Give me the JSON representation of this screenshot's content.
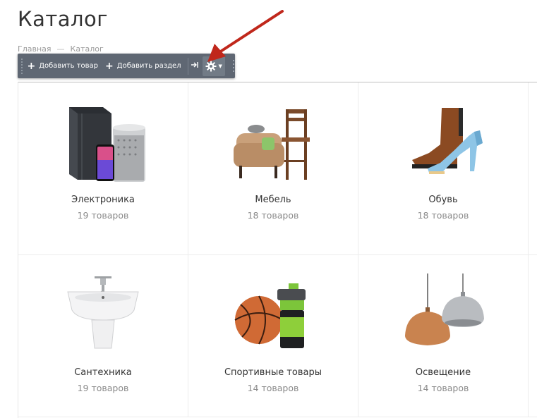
{
  "page": {
    "title": "Каталог",
    "breadcrumb": {
      "home": "Главная",
      "separator": "—",
      "current": "Каталог"
    }
  },
  "toolbar": {
    "add_item_label": "Добавить товар",
    "add_section_label": "Добавить раздел",
    "pin_icon": "pin-icon",
    "settings_icon": "gear-icon"
  },
  "catalog": {
    "items": [
      {
        "name": "Электроника",
        "count": "19 товаров",
        "icon": "electronics-image"
      },
      {
        "name": "Мебель",
        "count": "18 товаров",
        "icon": "furniture-image"
      },
      {
        "name": "Обувь",
        "count": "18 товаров",
        "icon": "shoes-image"
      },
      {
        "name": "Сантехника",
        "count": "19 товаров",
        "icon": "plumbing-image"
      },
      {
        "name": "Спортивные товары",
        "count": "14 товаров",
        "icon": "sports-image"
      },
      {
        "name": "Освещение",
        "count": "14 товаров",
        "icon": "lighting-image"
      }
    ]
  },
  "colors": {
    "toolbar_bg": "#5f6773",
    "annotation_arrow": "#c0271b"
  }
}
